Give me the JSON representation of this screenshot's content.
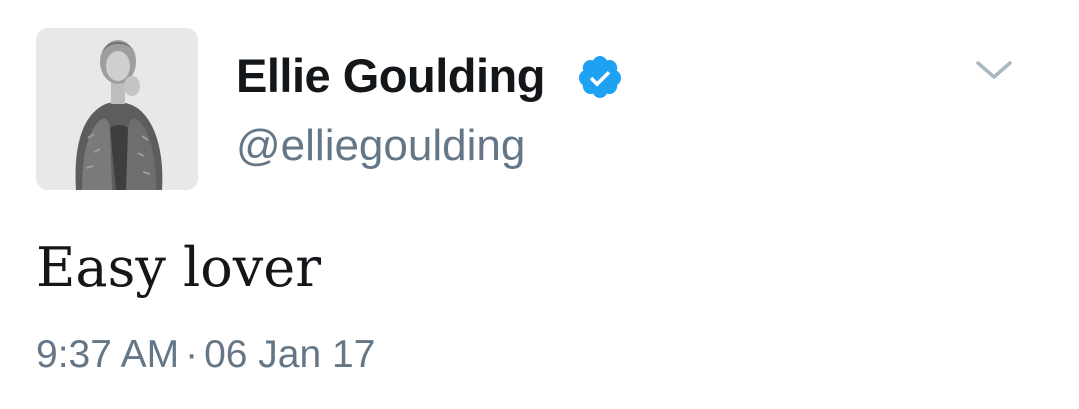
{
  "user": {
    "display_name": "Ellie Goulding",
    "handle": "@elliegoulding",
    "verified": true,
    "avatar_description": "avatar-photo"
  },
  "tweet": {
    "text": "Easy lover",
    "time": "9:37 AM",
    "separator": "·",
    "date": "06 Jan 17"
  },
  "icons": {
    "verified": "verified-badge-icon",
    "menu": "chevron-down-icon"
  },
  "colors": {
    "verified_blue": "#1DA1F2",
    "secondary_text": "#657786",
    "primary_text": "#14171A",
    "caret": "#AAB8C2"
  }
}
